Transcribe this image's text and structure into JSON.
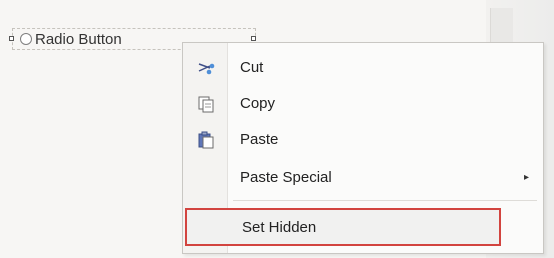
{
  "design_surface": {
    "radio_button_label": "Radio Button"
  },
  "context_menu": {
    "items": [
      {
        "label": "Cut",
        "icon": "scissors-icon"
      },
      {
        "label": "Copy",
        "icon": "copy-icon"
      },
      {
        "label": "Paste",
        "icon": "paste-icon"
      },
      {
        "label": "Paste Special",
        "icon": "submenu-arrow-icon"
      },
      {
        "label": "Set Hidden",
        "highlight_color": "#d2443f"
      }
    ]
  }
}
